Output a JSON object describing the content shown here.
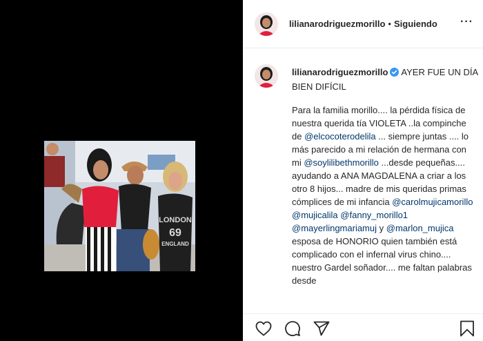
{
  "post": {
    "username": "lilianarodriguezmorillo",
    "header_separator": "•",
    "follow_status": "Siguiendo",
    "more_label": "···",
    "caption": {
      "headline": "AYER FUE UN DÍA BIEN DIFÍCIL",
      "p1": "Para la familia morillo.... la pérdida física de nuestra querida tía VIOLETA ..la compinche de",
      "m1": "@elcocoterodelila",
      "p2": " ... siempre juntas .... lo más parecido a mi relación de hermana con mi ",
      "m2": "@soylilibethmorillo",
      "p3": " ...desde pequeñas.... ayudando a ANA MAGDALENA a criar a los otro 8 hijos... madre de mis queridas primas cómplices de mi infancia ",
      "m3": "@carolmujicamorillo",
      "m4": "@mujicalila",
      "m5": "@fanny_morillo1",
      "m6": "@mayerlingmariamuj",
      "p4": " y ",
      "m7": "@marlon_mujica",
      "p5": " esposa de HONORIO quien también está complicado con el infernal virus chino.... nuestro Gardel soñador.... me faltan palabras desde"
    },
    "photo_shirt_text": "LONDON 69 ENGLAND"
  },
  "icons": {
    "like": "heart-icon",
    "comment": "comment-icon",
    "share": "share-icon",
    "save": "bookmark-icon",
    "verified": "verified-badge-icon"
  },
  "colors": {
    "mention": "#00376b",
    "verified": "#3897f0",
    "media_bg": "#000000"
  }
}
